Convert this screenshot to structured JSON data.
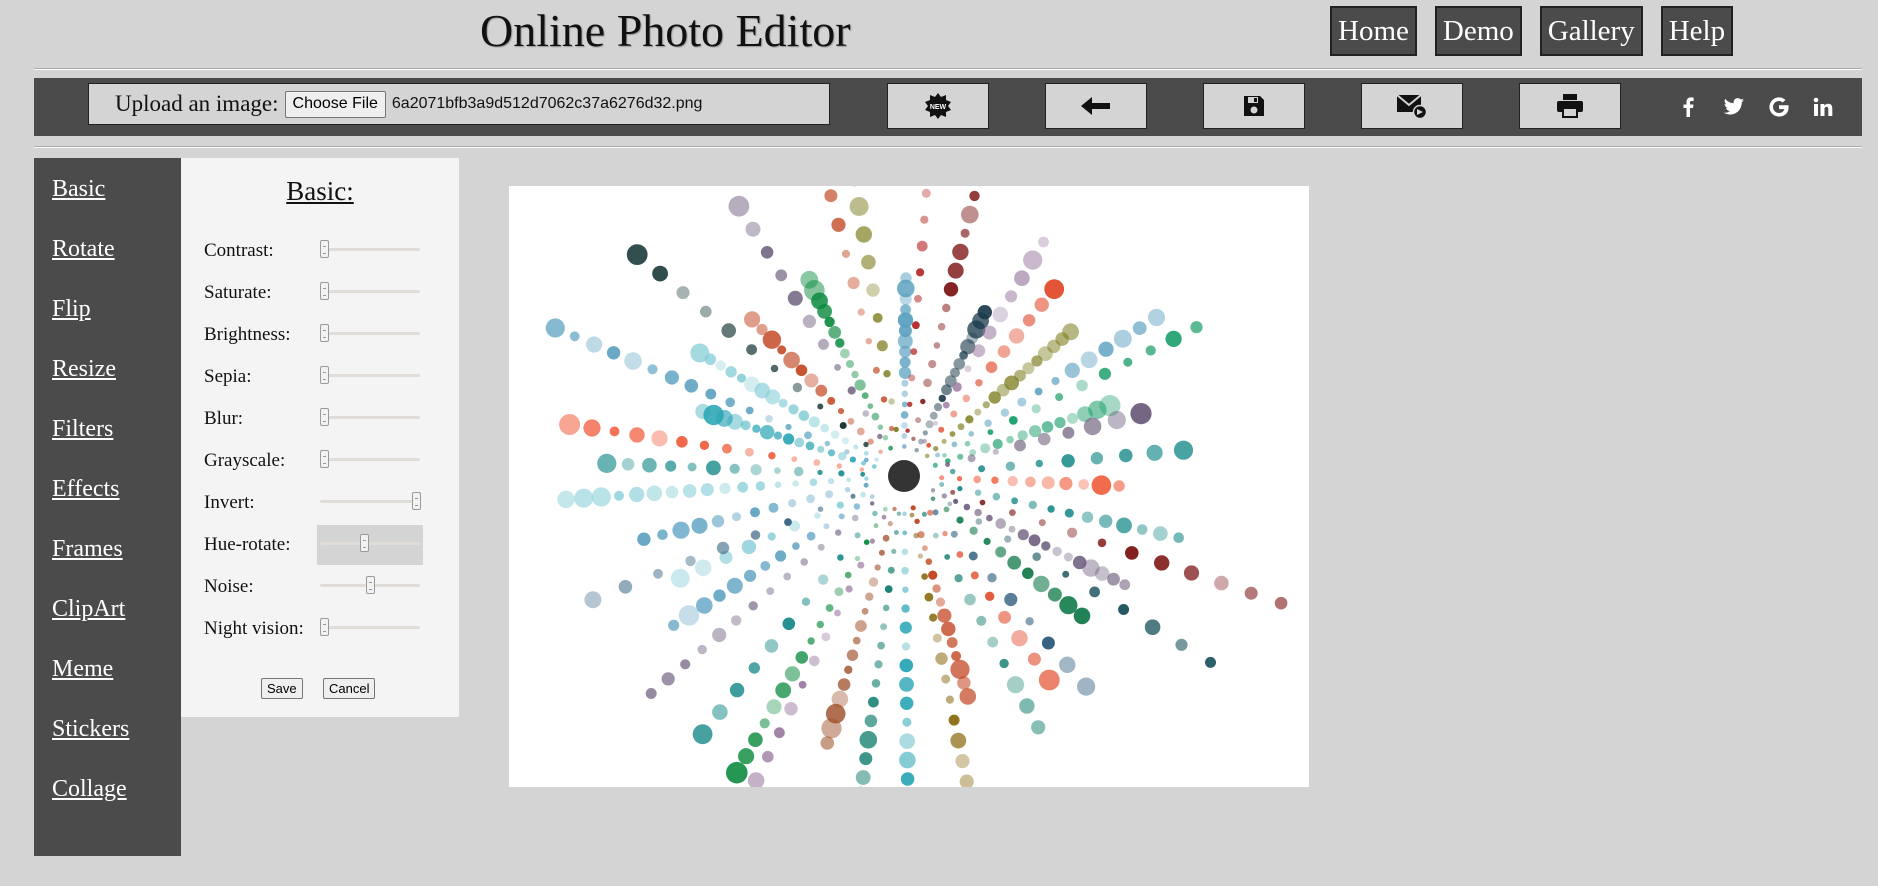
{
  "header": {
    "title": "Online Photo Editor",
    "nav": [
      "Home",
      "Demo",
      "Gallery",
      "Help"
    ]
  },
  "toolbar": {
    "upload_label": "Upload an image:",
    "choose_file_label": "Choose File",
    "file_name": "6a2071bfb3a9d512d7062c37a6276d32.png",
    "new_badge": "NEW",
    "social": [
      "f",
      "twitter",
      "G",
      "in"
    ]
  },
  "sidebar": {
    "items": [
      "Basic",
      "Rotate",
      "Flip",
      "Resize",
      "Filters",
      "Effects",
      "Frames",
      "ClipArt",
      "Meme",
      "Stickers",
      "Collage"
    ]
  },
  "panel": {
    "title": "Basic:",
    "controls": [
      {
        "label": "Contrast:",
        "value": 0.0
      },
      {
        "label": "Saturate:",
        "value": 0.0
      },
      {
        "label": "Brightness:",
        "value": 0.0
      },
      {
        "label": "Sepia:",
        "value": 0.0
      },
      {
        "label": "Blur:",
        "value": 0.0
      },
      {
        "label": "Grayscale:",
        "value": 0.0
      },
      {
        "label": "Invert:",
        "value": 1.0
      },
      {
        "label": "Hue-rotate:",
        "value": 0.44
      },
      {
        "label": "Noise:",
        "value": 0.5
      },
      {
        "label": "Night vision:",
        "value": 0.0
      }
    ],
    "save_label": "Save",
    "cancel_label": "Cancel"
  },
  "colors": {
    "background": "#d3d4d3",
    "bar": "#4b4b4b",
    "panel": "#f4f4f5"
  }
}
